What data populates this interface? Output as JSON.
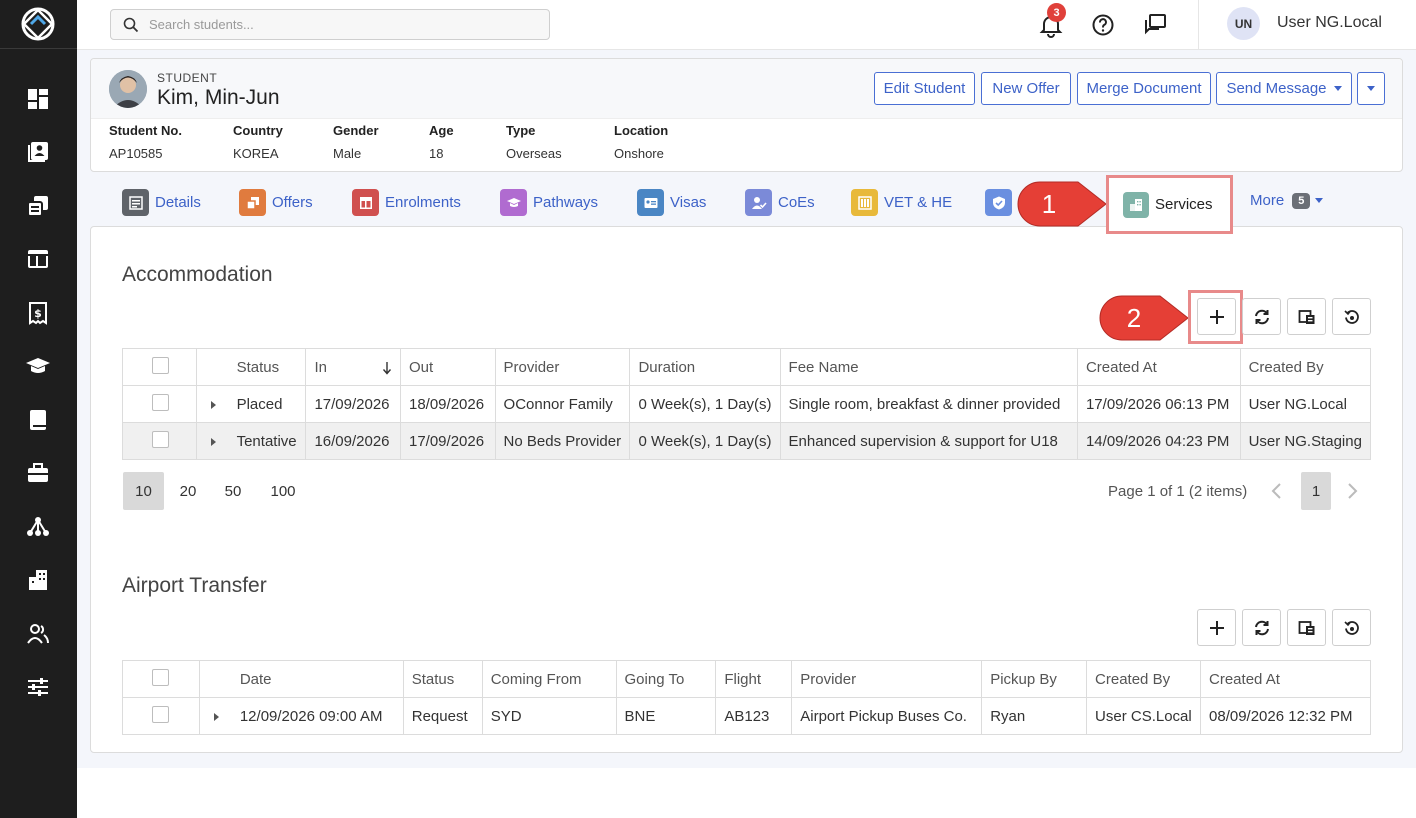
{
  "search": {
    "placeholder": "Search students..."
  },
  "header": {
    "notification_count": "3",
    "user_initials": "UN",
    "user_name": "User NG.Local"
  },
  "student": {
    "label": "STUDENT",
    "name": "Kim, Min-Jun",
    "fields": [
      {
        "label": "Student No.",
        "value": "AP10585"
      },
      {
        "label": "Country",
        "value": "KOREA"
      },
      {
        "label": "Gender",
        "value": "Male"
      },
      {
        "label": "Age",
        "value": "18"
      },
      {
        "label": "Type",
        "value": "Overseas"
      },
      {
        "label": "Location",
        "value": "Onshore"
      }
    ]
  },
  "actions": {
    "edit": "Edit Student",
    "new_offer": "New Offer",
    "merge": "Merge Document",
    "send_message": "Send Message"
  },
  "tabs": [
    {
      "label": "Details",
      "color": "#5f6369"
    },
    {
      "label": "Offers",
      "color": "#e07b3e"
    },
    {
      "label": "Enrolments",
      "color": "#d0504f"
    },
    {
      "label": "Pathways",
      "color": "#b06bd0"
    },
    {
      "label": "Visas",
      "color": "#4a86c4"
    },
    {
      "label": "CoEs",
      "color": "#7b8ad8"
    },
    {
      "label": "VET & HE",
      "color": "#e8b93a"
    },
    {
      "label": "",
      "color": "#6a8fe0"
    },
    {
      "label": "Services",
      "color": "#7fb3a8"
    },
    {
      "label": "More",
      "badge": "5"
    }
  ],
  "callouts": {
    "one": "1",
    "two": "2"
  },
  "accommodation": {
    "title": "Accommodation",
    "columns": [
      "Status",
      "In",
      "Out",
      "Provider",
      "Duration",
      "Fee Name",
      "Created At",
      "Created By"
    ],
    "rows": [
      {
        "status": "Placed",
        "in": "17/09/2026",
        "out": "18/09/2026",
        "provider": "OConnor Family",
        "duration": "0 Week(s), 1 Day(s)",
        "fee": "Single room, breakfast & dinner provided",
        "created_at": "17/09/2026 06:13 PM",
        "created_by": "User NG.Local"
      },
      {
        "status": "Tentative",
        "in": "16/09/2026",
        "out": "17/09/2026",
        "provider": "No Beds Provider",
        "duration": "0 Week(s), 1 Day(s)",
        "fee": "Enhanced supervision & support for U18",
        "created_at": "14/09/2026 04:23 PM",
        "created_by": "User NG.Staging"
      }
    ],
    "page_sizes": [
      "10",
      "20",
      "50",
      "100"
    ],
    "page_info": "Page 1 of 1 (2 items)",
    "current_page": "1"
  },
  "airport": {
    "title": "Airport Transfer",
    "columns": [
      "Date",
      "Status",
      "Coming From",
      "Going To",
      "Flight",
      "Provider",
      "Pickup By",
      "Created By",
      "Created At"
    ],
    "rows": [
      {
        "date": "12/09/2026 09:00 AM",
        "status": "Request",
        "from": "SYD",
        "to": "BNE",
        "flight": "AB123",
        "provider": "Airport Pickup Buses Co.",
        "pickup": "Ryan",
        "created_by": "User CS.Local",
        "created_at": "08/09/2026 12:32 PM"
      }
    ]
  }
}
